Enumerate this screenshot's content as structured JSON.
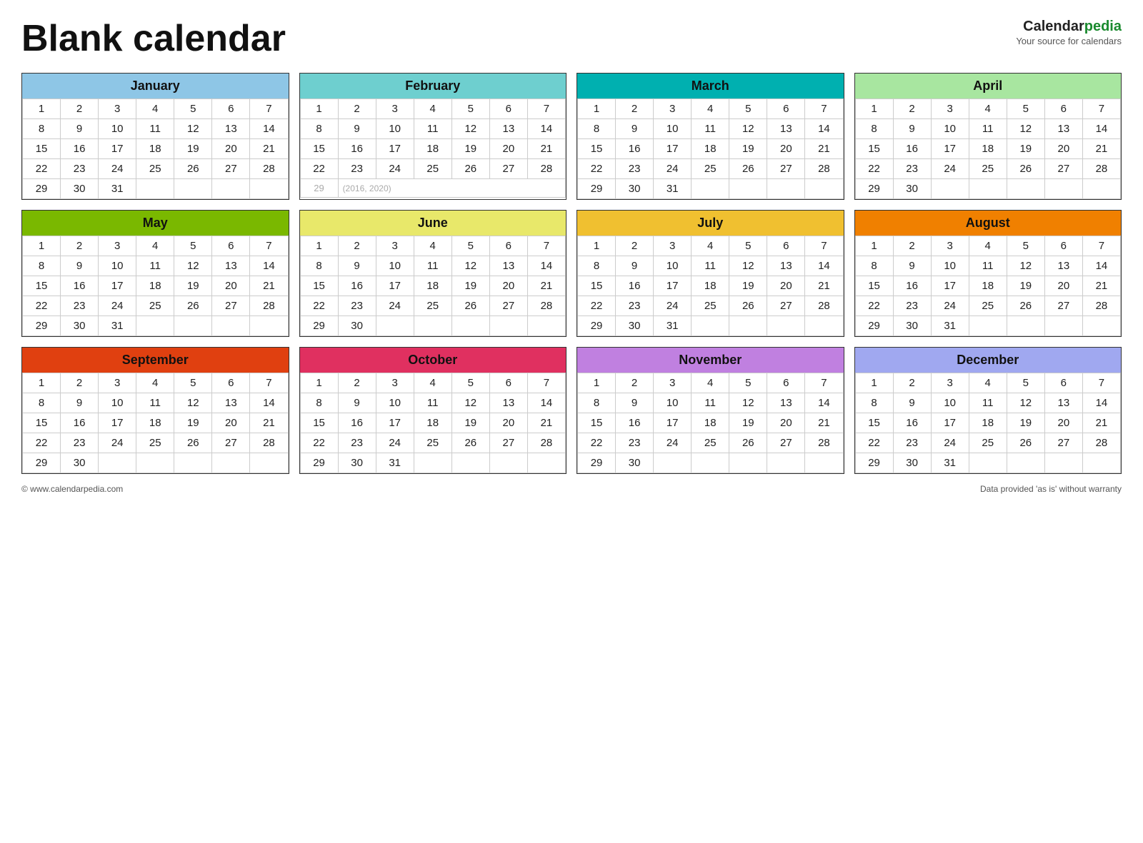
{
  "title": "Blank calendar",
  "brand": {
    "name_part1": "Calendar",
    "name_part2": "pedia",
    "tagline": "Your source for calendars"
  },
  "footer_left": "© www.calendarpedia.com",
  "footer_right": "Data provided 'as is' without warranty",
  "months": [
    {
      "name": "January",
      "color": "#8ec6e6",
      "weeks": [
        [
          1,
          2,
          3,
          4,
          5,
          6,
          7
        ],
        [
          8,
          9,
          10,
          11,
          12,
          13,
          14
        ],
        [
          15,
          16,
          17,
          18,
          19,
          20,
          21
        ],
        [
          22,
          23,
          24,
          25,
          26,
          27,
          28
        ],
        [
          29,
          30,
          31,
          null,
          null,
          null,
          null
        ]
      ]
    },
    {
      "name": "February",
      "color": "#6ecfcf",
      "weeks": [
        [
          1,
          2,
          3,
          4,
          5,
          6,
          7
        ],
        [
          8,
          9,
          10,
          11,
          12,
          13,
          14
        ],
        [
          15,
          16,
          17,
          18,
          19,
          20,
          21
        ],
        [
          22,
          23,
          24,
          25,
          26,
          27,
          28
        ],
        [
          "29_leap",
          "(2016, 2020)",
          null,
          null,
          null,
          null,
          null
        ]
      ]
    },
    {
      "name": "March",
      "color": "#00b0b0",
      "weeks": [
        [
          1,
          2,
          3,
          4,
          5,
          6,
          7
        ],
        [
          8,
          9,
          10,
          11,
          12,
          13,
          14
        ],
        [
          15,
          16,
          17,
          18,
          19,
          20,
          21
        ],
        [
          22,
          23,
          24,
          25,
          26,
          27,
          28
        ],
        [
          29,
          30,
          31,
          null,
          null,
          null,
          null
        ]
      ]
    },
    {
      "name": "April",
      "color": "#a8e6a0",
      "weeks": [
        [
          1,
          2,
          3,
          4,
          5,
          6,
          7
        ],
        [
          8,
          9,
          10,
          11,
          12,
          13,
          14
        ],
        [
          15,
          16,
          17,
          18,
          19,
          20,
          21
        ],
        [
          22,
          23,
          24,
          25,
          26,
          27,
          28
        ],
        [
          29,
          30,
          null,
          null,
          null,
          null,
          null
        ]
      ]
    },
    {
      "name": "May",
      "color": "#7ab800",
      "weeks": [
        [
          1,
          2,
          3,
          4,
          5,
          6,
          7
        ],
        [
          8,
          9,
          10,
          11,
          12,
          13,
          14
        ],
        [
          15,
          16,
          17,
          18,
          19,
          20,
          21
        ],
        [
          22,
          23,
          24,
          25,
          26,
          27,
          28
        ],
        [
          29,
          30,
          31,
          null,
          null,
          null,
          null
        ]
      ]
    },
    {
      "name": "June",
      "color": "#e8e86a",
      "weeks": [
        [
          1,
          2,
          3,
          4,
          5,
          6,
          7
        ],
        [
          8,
          9,
          10,
          11,
          12,
          13,
          14
        ],
        [
          15,
          16,
          17,
          18,
          19,
          20,
          21
        ],
        [
          22,
          23,
          24,
          25,
          26,
          27,
          28
        ],
        [
          29,
          30,
          null,
          null,
          null,
          null,
          null
        ]
      ]
    },
    {
      "name": "July",
      "color": "#f0c030",
      "weeks": [
        [
          1,
          2,
          3,
          4,
          5,
          6,
          7
        ],
        [
          8,
          9,
          10,
          11,
          12,
          13,
          14
        ],
        [
          15,
          16,
          17,
          18,
          19,
          20,
          21
        ],
        [
          22,
          23,
          24,
          25,
          26,
          27,
          28
        ],
        [
          29,
          30,
          31,
          null,
          null,
          null,
          null
        ]
      ]
    },
    {
      "name": "August",
      "color": "#f08000",
      "weeks": [
        [
          1,
          2,
          3,
          4,
          5,
          6,
          7
        ],
        [
          8,
          9,
          10,
          11,
          12,
          13,
          14
        ],
        [
          15,
          16,
          17,
          18,
          19,
          20,
          21
        ],
        [
          22,
          23,
          24,
          25,
          26,
          27,
          28
        ],
        [
          29,
          30,
          31,
          null,
          null,
          null,
          null
        ]
      ]
    },
    {
      "name": "September",
      "color": "#e04010",
      "weeks": [
        [
          1,
          2,
          3,
          4,
          5,
          6,
          7
        ],
        [
          8,
          9,
          10,
          11,
          12,
          13,
          14
        ],
        [
          15,
          16,
          17,
          18,
          19,
          20,
          21
        ],
        [
          22,
          23,
          24,
          25,
          26,
          27,
          28
        ],
        [
          29,
          30,
          null,
          null,
          null,
          null,
          null
        ]
      ]
    },
    {
      "name": "October",
      "color": "#e03060",
      "weeks": [
        [
          1,
          2,
          3,
          4,
          5,
          6,
          7
        ],
        [
          8,
          9,
          10,
          11,
          12,
          13,
          14
        ],
        [
          15,
          16,
          17,
          18,
          19,
          20,
          21
        ],
        [
          22,
          23,
          24,
          25,
          26,
          27,
          28
        ],
        [
          29,
          30,
          31,
          null,
          null,
          null,
          null
        ]
      ]
    },
    {
      "name": "November",
      "color": "#c080e0",
      "weeks": [
        [
          1,
          2,
          3,
          4,
          5,
          6,
          7
        ],
        [
          8,
          9,
          10,
          11,
          12,
          13,
          14
        ],
        [
          15,
          16,
          17,
          18,
          19,
          20,
          21
        ],
        [
          22,
          23,
          24,
          25,
          26,
          27,
          28
        ],
        [
          29,
          30,
          null,
          null,
          null,
          null,
          null
        ]
      ]
    },
    {
      "name": "December",
      "color": "#a0a8f0",
      "weeks": [
        [
          1,
          2,
          3,
          4,
          5,
          6,
          7
        ],
        [
          8,
          9,
          10,
          11,
          12,
          13,
          14
        ],
        [
          15,
          16,
          17,
          18,
          19,
          20,
          21
        ],
        [
          22,
          23,
          24,
          25,
          26,
          27,
          28
        ],
        [
          29,
          30,
          31,
          null,
          null,
          null,
          null
        ]
      ]
    }
  ]
}
